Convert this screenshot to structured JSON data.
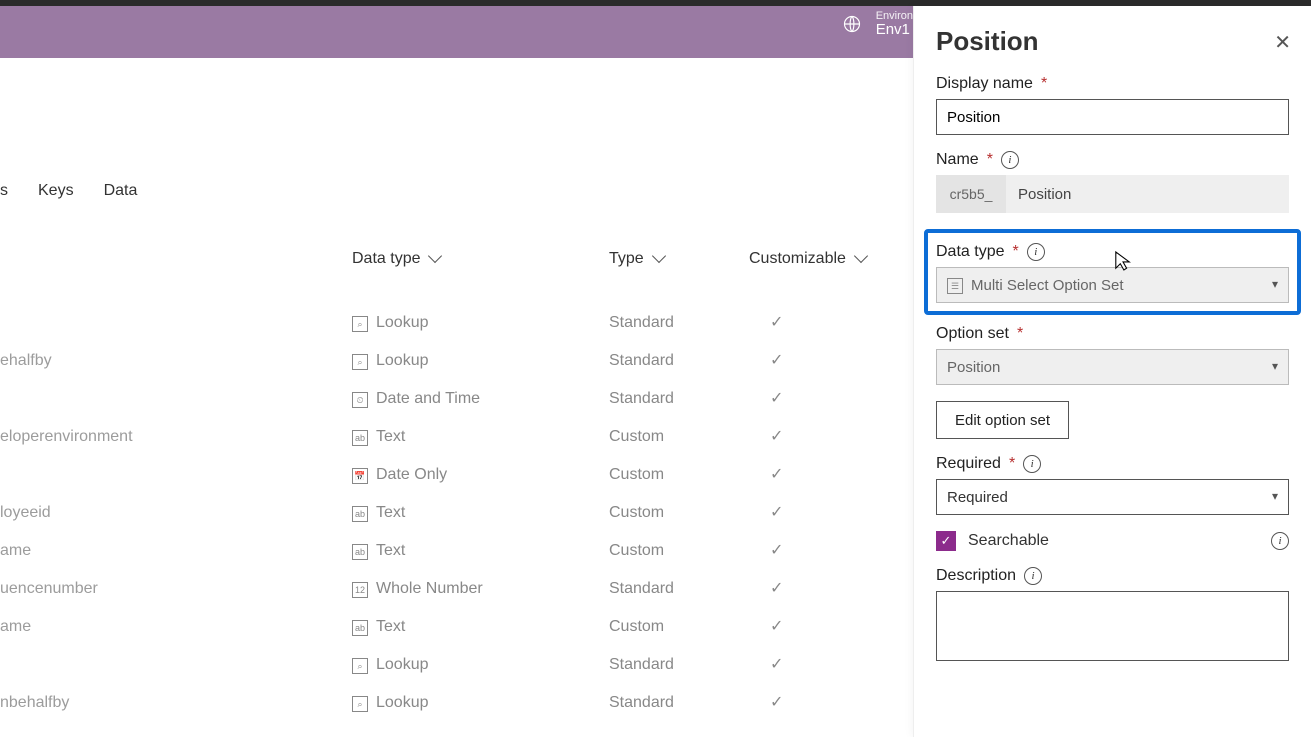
{
  "header": {
    "env_label": "Environ",
    "env_value": "Env1"
  },
  "tabs": {
    "t1": "s",
    "t2": "Keys",
    "t3": "Data"
  },
  "columns": {
    "datatype": "Data type",
    "type": "Type",
    "customizable": "Customizable"
  },
  "rows": [
    {
      "name": "",
      "dt": "Lookup",
      "type": "Standard"
    },
    {
      "name": "ehalfby",
      "dt": "Lookup",
      "type": "Standard"
    },
    {
      "name": "",
      "dt": "Date and Time",
      "type": "Standard"
    },
    {
      "name": "eloperenvironment",
      "dt": "Text",
      "type": "Custom"
    },
    {
      "name": "",
      "dt": "Date Only",
      "type": "Custom"
    },
    {
      "name": "loyeeid",
      "dt": "Text",
      "type": "Custom"
    },
    {
      "name": "ame",
      "dt": "Text",
      "type": "Custom"
    },
    {
      "name": "uencenumber",
      "dt": "Whole Number",
      "type": "Standard"
    },
    {
      "name": "ame",
      "dt": "Text",
      "type": "Custom"
    },
    {
      "name": "",
      "dt": "Lookup",
      "type": "Standard"
    },
    {
      "name": "nbehalfby",
      "dt": "Lookup",
      "type": "Standard"
    }
  ],
  "panel": {
    "title": "Position",
    "display_name_label": "Display name",
    "display_name_value": "Position",
    "name_label": "Name",
    "name_prefix": "cr5b5_",
    "name_value": "Position",
    "data_type_label": "Data type",
    "data_type_value": "Multi Select Option Set",
    "option_set_label": "Option set",
    "option_set_value": "Position",
    "edit_option_set": "Edit option set",
    "required_label": "Required",
    "required_value": "Required",
    "searchable": "Searchable",
    "description_label": "Description",
    "description_value": ""
  }
}
